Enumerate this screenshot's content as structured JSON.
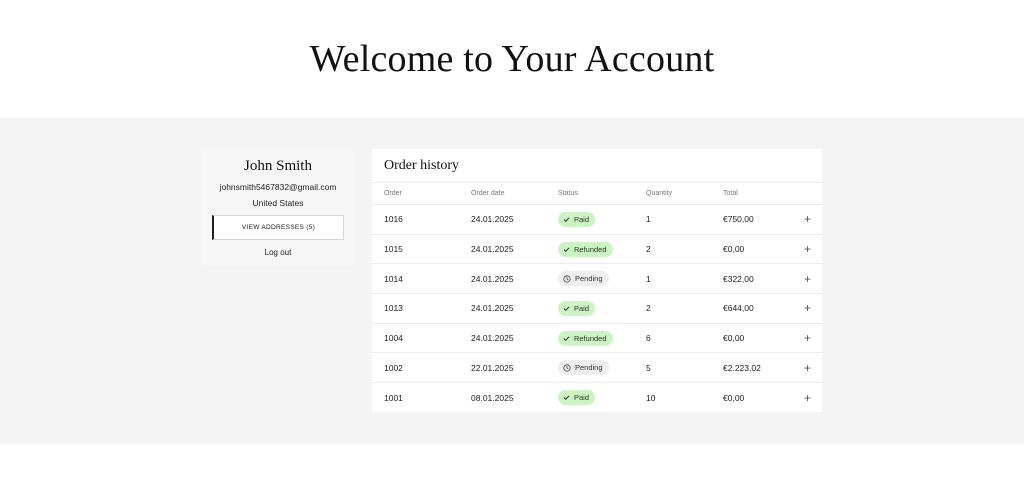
{
  "page": {
    "title": "Welcome to Your Account"
  },
  "profile": {
    "name": "John Smith",
    "email": "johnsmith5467832@gmail.com",
    "country": "United States",
    "addresses_button": "VIEW ADDRESSES (5)",
    "logout": "Log out"
  },
  "orders": {
    "title": "Order history",
    "headers": {
      "order": "Order",
      "date": "Order date",
      "status": "Status",
      "quantity": "Quantity",
      "total": "Total"
    },
    "rows": [
      {
        "order": "1016",
        "date": "24.01.2025",
        "status": "Paid",
        "quantity": "1",
        "total": "€750,00"
      },
      {
        "order": "1015",
        "date": "24.01.2025",
        "status": "Refunded",
        "quantity": "2",
        "total": "€0,00"
      },
      {
        "order": "1014",
        "date": "24.01.2025",
        "status": "Pending",
        "quantity": "1",
        "total": "€322,00"
      },
      {
        "order": "1013",
        "date": "24.01.2025",
        "status": "Paid",
        "quantity": "2",
        "total": "€644,00"
      },
      {
        "order": "1004",
        "date": "24.01.2025",
        "status": "Refunded",
        "quantity": "6",
        "total": "€0,00"
      },
      {
        "order": "1002",
        "date": "22.01.2025",
        "status": "Pending",
        "quantity": "5",
        "total": "€2.223,02"
      },
      {
        "order": "1001",
        "date": "08.01.2025",
        "status": "Paid",
        "quantity": "10",
        "total": "€0,00"
      }
    ]
  },
  "colors": {
    "band": "#f4f4f4",
    "badge_ok": "#cdf2c3",
    "badge_pending": "#eeeeee"
  }
}
